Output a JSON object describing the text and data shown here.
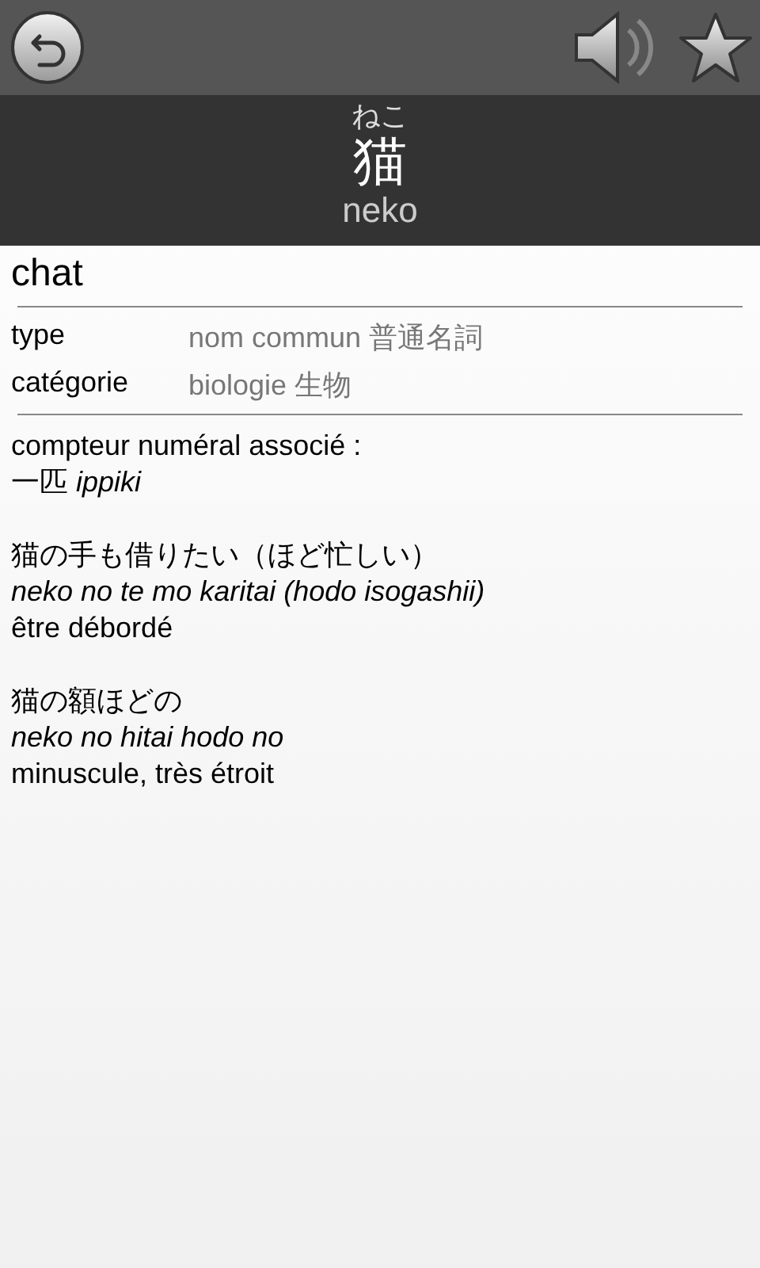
{
  "header": {
    "kana": "ねこ",
    "kanji": "猫",
    "romaji": "neko"
  },
  "translation": "chat",
  "properties": [
    {
      "label": "type",
      "value": "nom commun 普通名詞"
    },
    {
      "label": "catégorie",
      "value": "biologie 生物"
    }
  ],
  "counter": {
    "label": "compteur numéral associé :",
    "reading": "一匹 *ippiki*"
  },
  "expressions": [
    {
      "japanese": "猫の手も借りたい（ほど忙しい）",
      "romaji": "neko no te mo karitai (hodo isogashii)",
      "meaning": "être débordé"
    },
    {
      "japanese": "猫の額ほどの",
      "romaji": "neko no hitai hodo no",
      "meaning": "minuscule, très étroit"
    }
  ]
}
